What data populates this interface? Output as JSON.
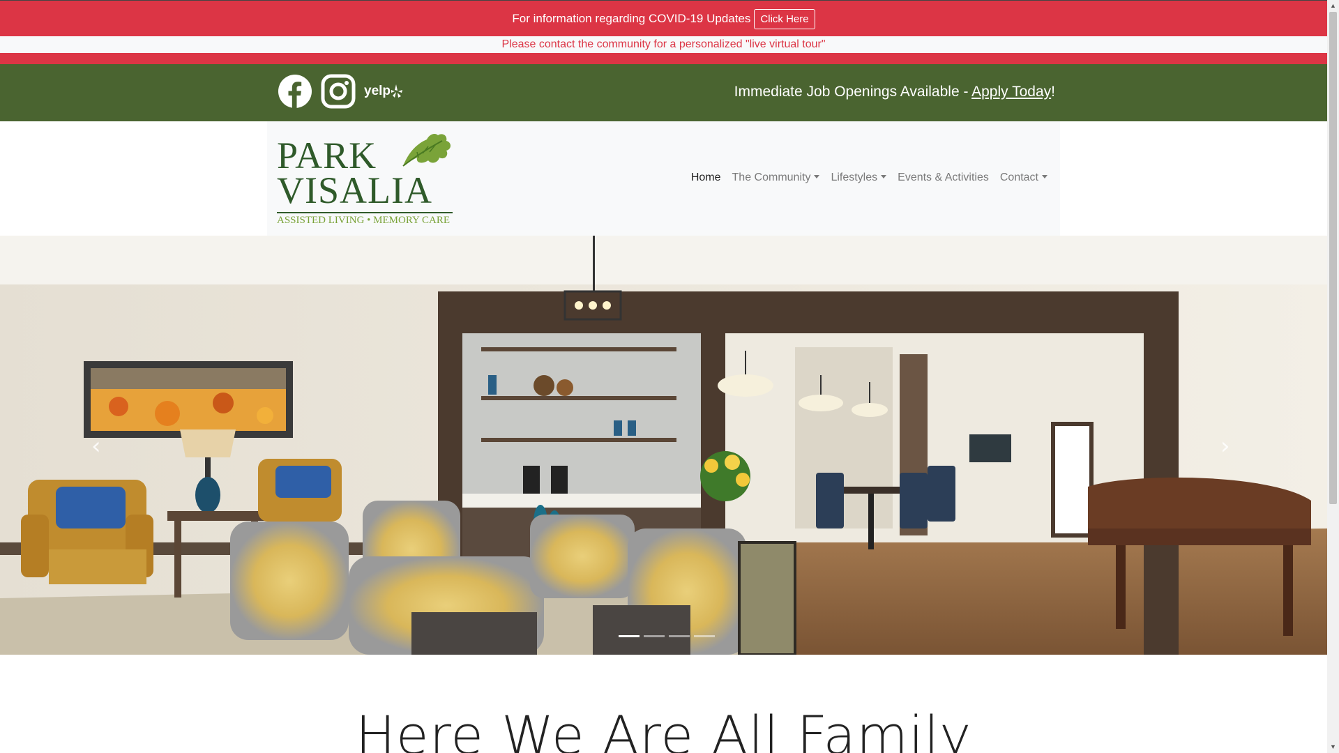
{
  "announcement": {
    "covid_text": "For information regarding COVID-19 Updates",
    "covid_button": "Click Here",
    "tour_text": "Please contact the community for a personalized \"live virtual tour\""
  },
  "social": {
    "icons": [
      "facebook-icon",
      "instagram-icon",
      "yelp-icon"
    ],
    "yelp_label": "yelp"
  },
  "jobs": {
    "text_prefix": "Immediate Job Openings Available - ",
    "link": "Apply Today",
    "suffix": "!"
  },
  "logo": {
    "line1": "PARK",
    "line2": "VISALIA",
    "tagline": "ASSISTED LIVING • MEMORY CARE"
  },
  "nav": {
    "home": "Home",
    "community": "The Community",
    "lifestyles": "Lifestyles",
    "events": "Events & Activities",
    "contact": "Contact"
  },
  "hero": {
    "prev_arrow": "‹",
    "next_arrow": "›",
    "slide_count": 4,
    "active_slide": 1
  },
  "headline": "Here We Are All Family",
  "colors": {
    "alert_red": "#dc3545",
    "brand_green": "#4a6430",
    "logo_green": "#2f5a2a",
    "leaf_green": "#7aa339"
  }
}
